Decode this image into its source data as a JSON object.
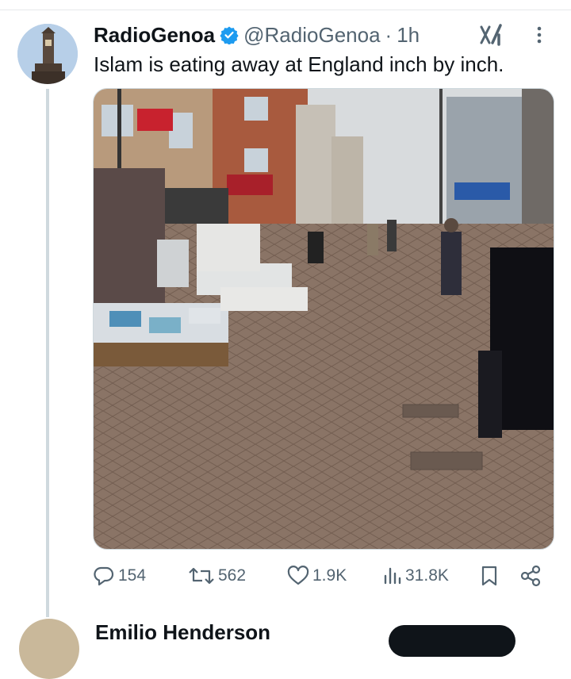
{
  "tweet": {
    "author_name": "RadioGenoa",
    "handle": "@RadioGenoa",
    "separator": "·",
    "time": "1h",
    "text": "Islam is eating away at England inch by inch.",
    "verified": true
  },
  "actions": {
    "replies": "154",
    "reposts": "562",
    "likes": "1.9K",
    "views": "31.8K"
  },
  "next_tweet": {
    "author_name": "Emilio Henderson"
  },
  "colors": {
    "verified_blue": "#1d9bf0",
    "secondary_text": "#536471",
    "thread_line": "#cfd9de"
  },
  "icons": [
    "verified-badge-icon",
    "grok-icon",
    "more-icon",
    "mute-icon",
    "reply-icon",
    "repost-icon",
    "like-icon",
    "views-icon",
    "bookmark-icon",
    "share-icon"
  ]
}
